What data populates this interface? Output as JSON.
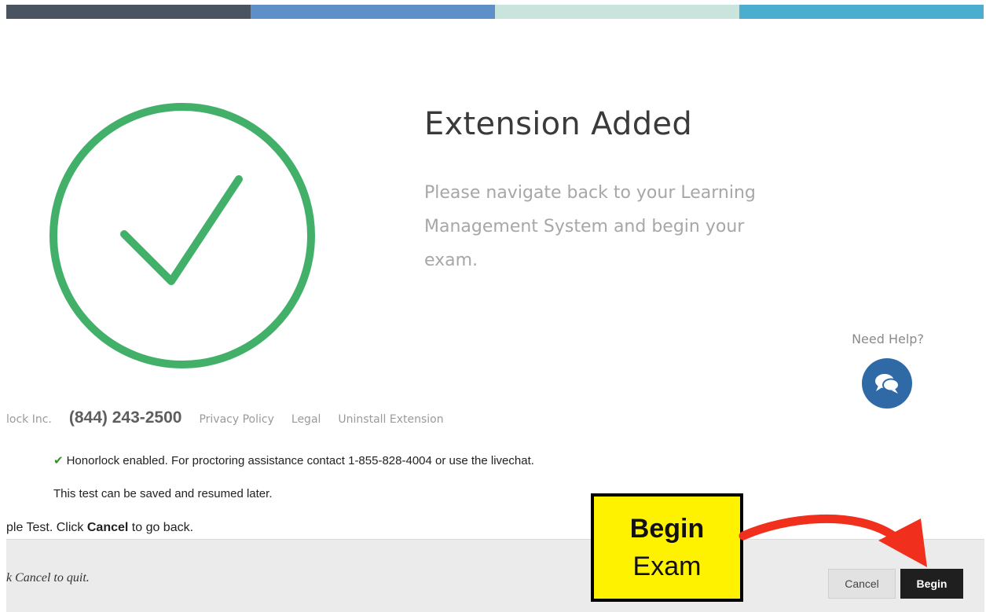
{
  "colors": {
    "top_bar": [
      "#4a5460",
      "#5f8fc9",
      "#c8e4dd",
      "#4baed0"
    ],
    "success_green": "#43b06a",
    "help_button": "#2f6aa7",
    "callout_yellow": "#fff200",
    "arrow_red": "#f0301c"
  },
  "icons": {
    "status": "check-circle-icon",
    "help": "chat-bubbles-icon",
    "callout_arrow": "curved-arrow-icon"
  },
  "main": {
    "title": "Extension Added",
    "message": "Please navigate back to your Learning Management System and begin your exam."
  },
  "help": {
    "label": "Need Help?"
  },
  "footer": {
    "company": "lock Inc.",
    "phone": "(844) 243-2500",
    "links": [
      "Privacy Policy",
      "Legal",
      "Uninstall Extension"
    ]
  },
  "exam": {
    "status_check": "✔",
    "status_text": "Honorlock enabled. For proctoring assistance contact 1-855-828-4004 or use the livechat.",
    "save_text": "This test can be saved and resumed later.",
    "cancel_prefix": "ple Test. Click ",
    "cancel_bold": "Cancel",
    "cancel_suffix": " to go back.",
    "quit_note": "k Cancel to quit.",
    "cancel_button": "Cancel",
    "begin_button": "Begin"
  },
  "callout": {
    "line1": "Begin",
    "line2": "Exam"
  }
}
